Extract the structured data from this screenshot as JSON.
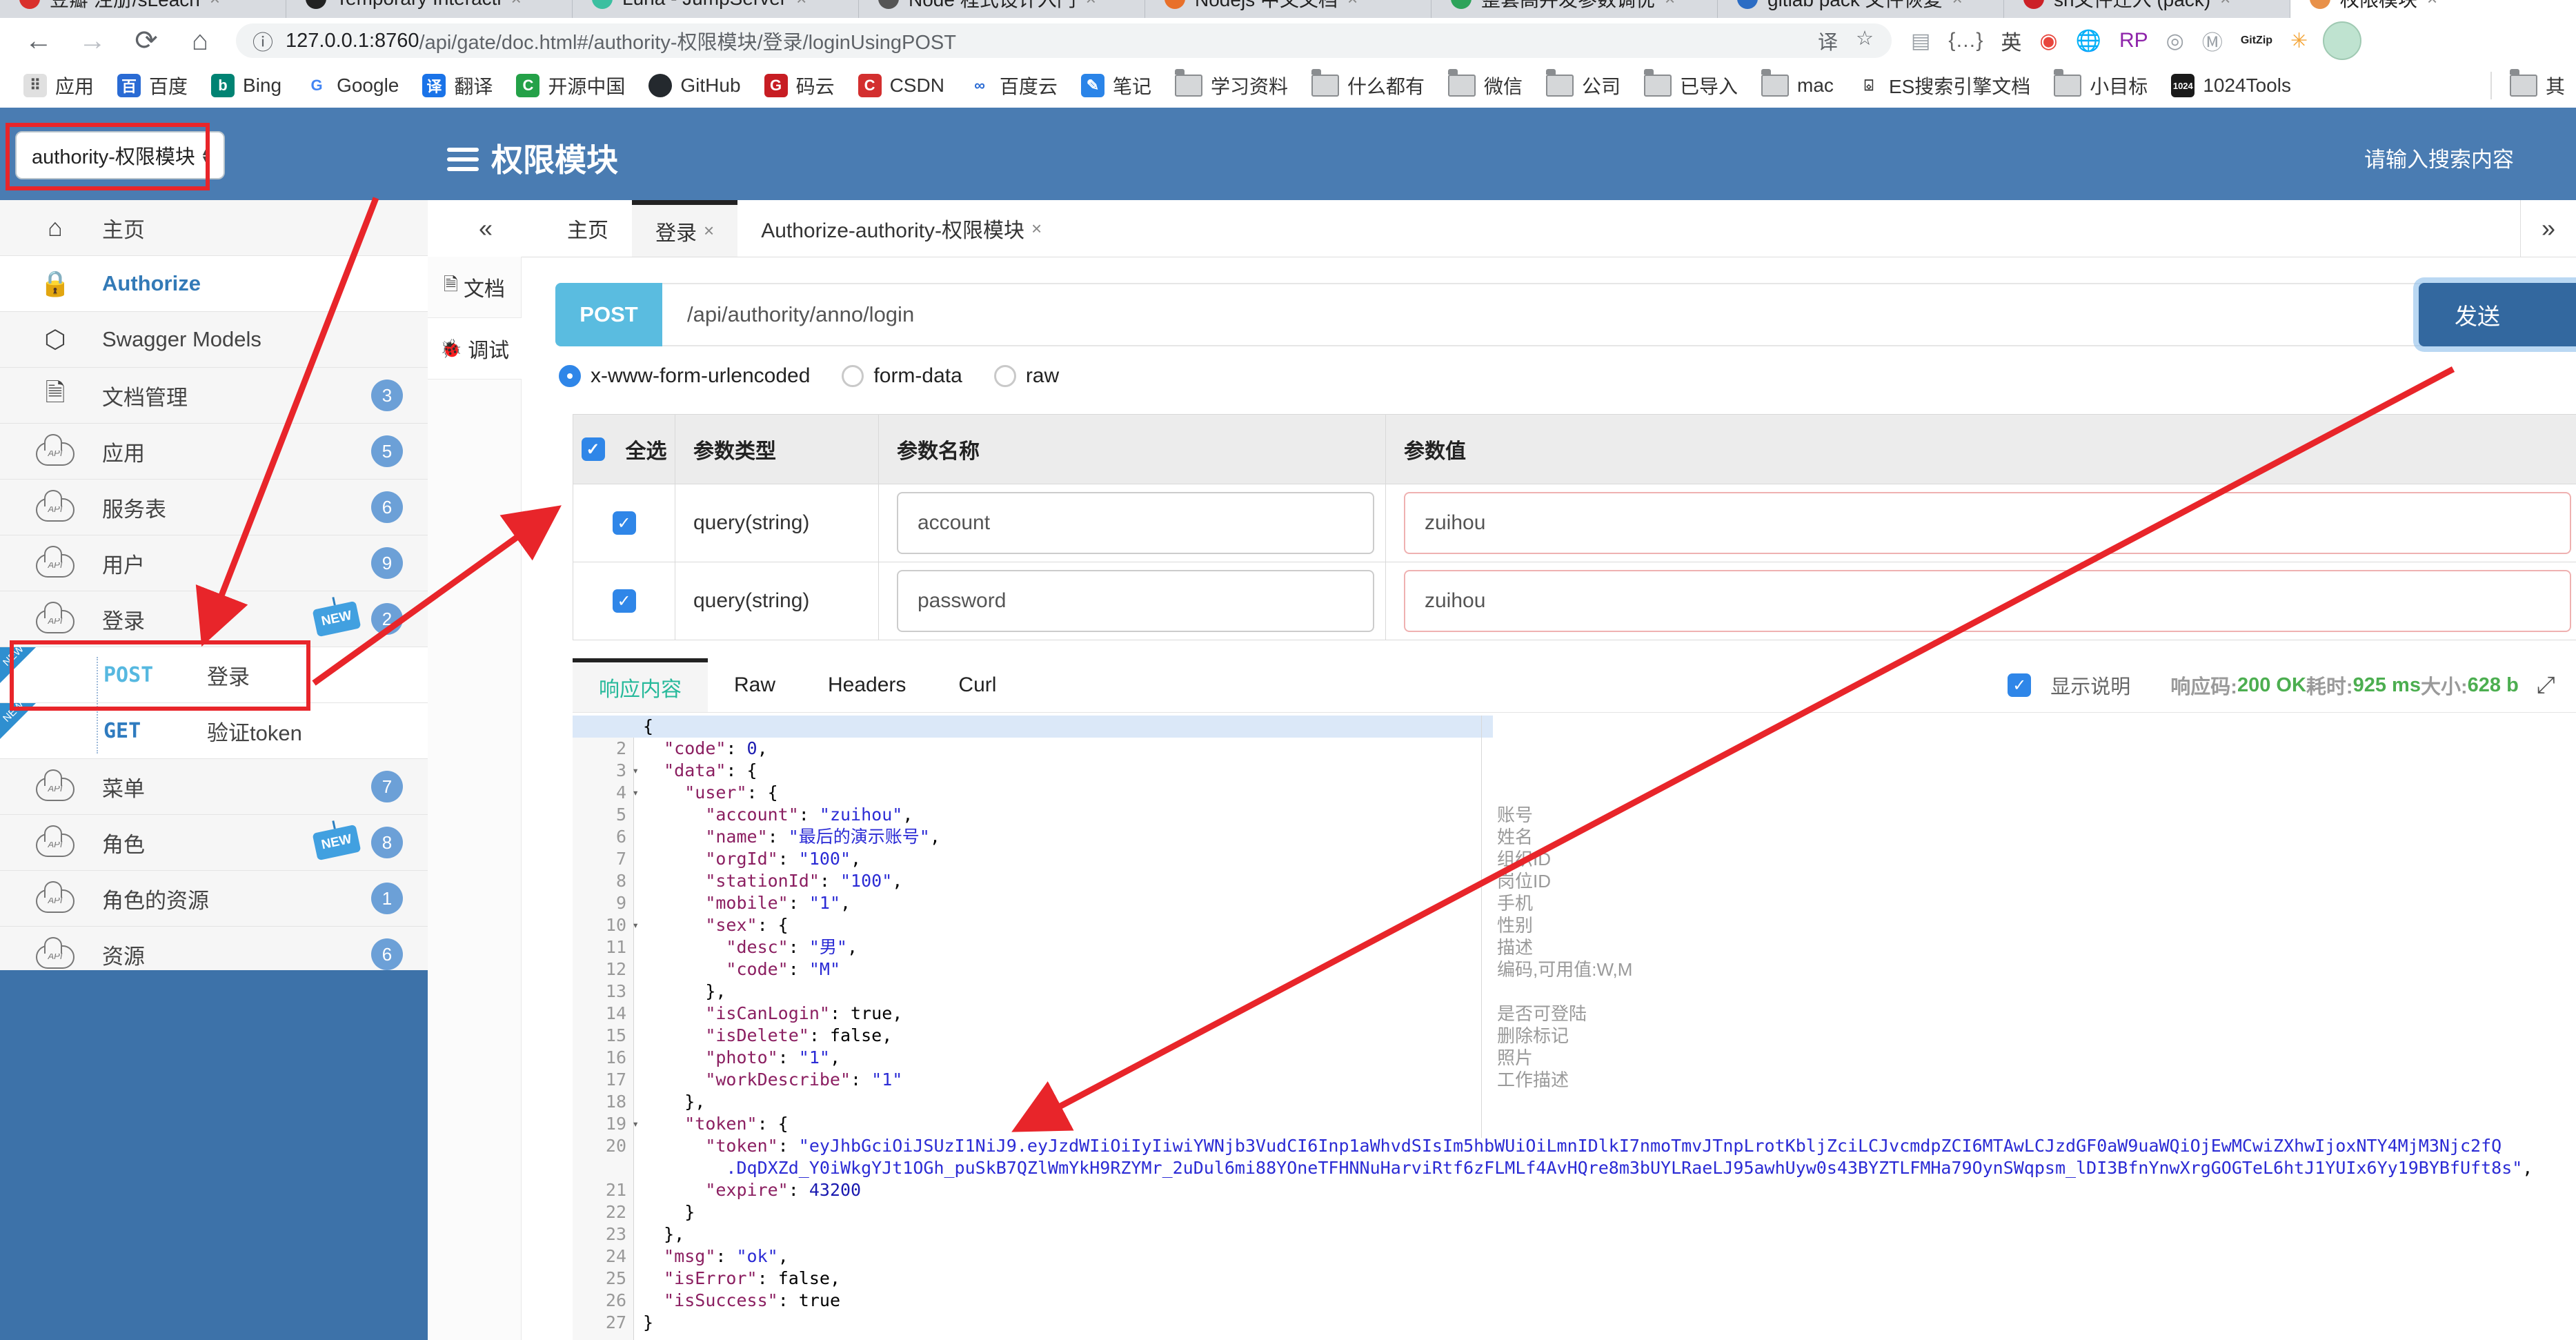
{
  "browser": {
    "tabs": [
      {
        "title": "豆瓣 注册/sLeach",
        "color": "#d9302c",
        "active": false
      },
      {
        "title": "Temporary Interacti",
        "color": "#222222",
        "active": false
      },
      {
        "title": "Luna - JumpServer",
        "color": "#3bbfa0",
        "active": false
      },
      {
        "title": "Node 程式设计入门",
        "color": "#555555",
        "active": false
      },
      {
        "title": "Nodejs 中文文档",
        "color": "#e8702a",
        "active": false
      },
      {
        "title": "整套高并发参数调优",
        "color": "#2da35a",
        "active": false
      },
      {
        "title": "gitlab pack 文件恢复",
        "color": "#2b6cc4",
        "active": false
      },
      {
        "title": "sh文件迁入 (pack)",
        "color": "#cc2127",
        "active": false
      },
      {
        "title": "权限模块",
        "color": "#e8914a",
        "active": true
      }
    ],
    "nav": {
      "back": "←",
      "forward": "→",
      "reload": "⟳",
      "home": "⌂"
    },
    "url": {
      "info_icon": "ⓘ",
      "host": "127.0.0.1:8760",
      "path": "/api/gate/doc.html#/authority-权限模块/登录/loginUsingPOST"
    },
    "pill_icons": {
      "translate": "译",
      "star": "☆"
    },
    "extensions": [
      "reader",
      "json",
      "en-translate",
      "chrome",
      "globe",
      "rp",
      "ring",
      "shield-m",
      "gitzip",
      "asterisk"
    ],
    "bookmarks": [
      {
        "label": "应用",
        "icon": "grid"
      },
      {
        "label": "百度",
        "icon": "blue-paw"
      },
      {
        "label": "Bing",
        "icon": "teal-b"
      },
      {
        "label": "Google",
        "icon": "g"
      },
      {
        "label": "翻译",
        "icon": "blue-trans"
      },
      {
        "label": "开源中国",
        "icon": "green-c"
      },
      {
        "label": "GitHub",
        "icon": "black-cat"
      },
      {
        "label": "码云",
        "icon": "red-g"
      },
      {
        "label": "CSDN",
        "icon": "red-c"
      },
      {
        "label": "百度云",
        "icon": "pan"
      },
      {
        "label": "笔记",
        "icon": "blue-note"
      },
      {
        "label": "学习资料",
        "icon": "folder"
      },
      {
        "label": "什么都有",
        "icon": "folder"
      },
      {
        "label": "微信",
        "icon": "folder"
      },
      {
        "label": "公司",
        "icon": "folder"
      },
      {
        "label": "已导入",
        "icon": "folder"
      },
      {
        "label": "mac",
        "icon": "folder"
      },
      {
        "label": "ES搜索引擎文档",
        "icon": "book"
      },
      {
        "label": "小目标",
        "icon": "folder"
      },
      {
        "label": "1024Tools",
        "icon": "tools1024"
      }
    ],
    "bookmarks_more": "其"
  },
  "header": {
    "module_select": "authority-权限模块",
    "title": "权限模块",
    "search_placeholder": "请输入搜索内容"
  },
  "sidebar": {
    "items": [
      {
        "label": "主页",
        "icon": "home",
        "type": "plain"
      },
      {
        "label": "Authorize",
        "icon": "lock",
        "type": "active"
      },
      {
        "label": "Swagger Models",
        "icon": "hexagon",
        "type": "plain"
      },
      {
        "label": "文档管理",
        "icon": "doc-gear",
        "type": "plain",
        "badge": "3"
      },
      {
        "label": "应用",
        "icon": "cloud-api",
        "type": "plain",
        "badge": "5"
      },
      {
        "label": "服务表",
        "icon": "cloud-api",
        "type": "plain",
        "badge": "6"
      },
      {
        "label": "用户",
        "icon": "cloud-api",
        "type": "plain",
        "badge": "9"
      },
      {
        "label": "登录",
        "icon": "cloud-api",
        "type": "plain",
        "badge": "2",
        "new": true
      },
      {
        "label": "登录",
        "method": "POST",
        "type": "sub",
        "new": true
      },
      {
        "label": "验证token",
        "method": "GET",
        "type": "sub",
        "new": true
      },
      {
        "label": "菜单",
        "icon": "cloud-api",
        "type": "plain",
        "badge": "7"
      },
      {
        "label": "角色",
        "icon": "cloud-api",
        "type": "plain",
        "badge": "8",
        "new": true
      },
      {
        "label": "角色的资源",
        "icon": "cloud-api",
        "type": "plain",
        "badge": "1"
      },
      {
        "label": "资源",
        "icon": "cloud-api",
        "type": "plain",
        "badge": "6"
      }
    ],
    "new_label": "NEW"
  },
  "tabs": {
    "collapse": "«",
    "expand": "»",
    "items": [
      {
        "label": "主页",
        "closable": false,
        "active": false
      },
      {
        "label": "登录",
        "closable": true,
        "active": true
      },
      {
        "label": "Authorize-authority-权限模块",
        "closable": true,
        "active": false
      }
    ],
    "close_glyph": "×"
  },
  "doc_tabs": [
    {
      "label": "文档",
      "icon": "doc",
      "active": false
    },
    {
      "label": "调试",
      "icon": "bug",
      "active": true
    }
  ],
  "request": {
    "method": "POST",
    "url": "/api/authority/anno/login",
    "send_label": "发送",
    "body_types": [
      "x-www-form-urlencoded",
      "form-data",
      "raw"
    ],
    "selected_body": "x-www-form-urlencoded"
  },
  "params": {
    "headers": {
      "select_all": "全选",
      "type": "参数类型",
      "name": "参数名称",
      "value": "参数值"
    },
    "rows": [
      {
        "type": "query(string)",
        "name": "account",
        "value": "zuihou"
      },
      {
        "type": "query(string)",
        "name": "password",
        "value": "zuihou"
      }
    ]
  },
  "response": {
    "tabs": [
      "响应内容",
      "Raw",
      "Headers",
      "Curl"
    ],
    "active_tab": "响应内容",
    "show_desc_label": "显示说明",
    "meta": [
      {
        "label": "响应码:",
        "value": "200 OK"
      },
      {
        "label": "耗时:",
        "value": "925 ms"
      },
      {
        "label": "大小:",
        "value": "628 b"
      }
    ],
    "expand_icon": "⤢"
  },
  "code": {
    "rows": [
      {
        "n": "1",
        "fold": true,
        "indent": 0,
        "seg": [
          [
            "p",
            "{"
          ]
        ],
        "hl": true
      },
      {
        "n": "2",
        "fold": false,
        "indent": 1,
        "seg": [
          [
            "k",
            "\"code\""
          ],
          [
            "p",
            ": "
          ],
          [
            "n",
            "0"
          ],
          [
            "p",
            ","
          ]
        ]
      },
      {
        "n": "3",
        "fold": true,
        "indent": 1,
        "seg": [
          [
            "k",
            "\"data\""
          ],
          [
            "p",
            ": {"
          ]
        ]
      },
      {
        "n": "4",
        "fold": true,
        "indent": 2,
        "seg": [
          [
            "k",
            "\"user\""
          ],
          [
            "p",
            ": {"
          ]
        ]
      },
      {
        "n": "5",
        "fold": false,
        "indent": 3,
        "seg": [
          [
            "k",
            "\"account\""
          ],
          [
            "p",
            ": "
          ],
          [
            "s",
            "\"zuihou\""
          ],
          [
            "p",
            ","
          ]
        ]
      },
      {
        "n": "6",
        "fold": false,
        "indent": 3,
        "seg": [
          [
            "k",
            "\"name\""
          ],
          [
            "p",
            ": "
          ],
          [
            "s",
            "\"最后的演示账号\""
          ],
          [
            "p",
            ","
          ]
        ]
      },
      {
        "n": "7",
        "fold": false,
        "indent": 3,
        "seg": [
          [
            "k",
            "\"orgId\""
          ],
          [
            "p",
            ": "
          ],
          [
            "s",
            "\"100\""
          ],
          [
            "p",
            ","
          ]
        ]
      },
      {
        "n": "8",
        "fold": false,
        "indent": 3,
        "seg": [
          [
            "k",
            "\"stationId\""
          ],
          [
            "p",
            ": "
          ],
          [
            "s",
            "\"100\""
          ],
          [
            "p",
            ","
          ]
        ]
      },
      {
        "n": "9",
        "fold": false,
        "indent": 3,
        "seg": [
          [
            "k",
            "\"mobile\""
          ],
          [
            "p",
            ": "
          ],
          [
            "s",
            "\"1\""
          ],
          [
            "p",
            ","
          ]
        ]
      },
      {
        "n": "10",
        "fold": true,
        "indent": 3,
        "seg": [
          [
            "k",
            "\"sex\""
          ],
          [
            "p",
            ": {"
          ]
        ]
      },
      {
        "n": "11",
        "fold": false,
        "indent": 4,
        "seg": [
          [
            "k",
            "\"desc\""
          ],
          [
            "p",
            ": "
          ],
          [
            "s",
            "\"男\""
          ],
          [
            "p",
            ","
          ]
        ]
      },
      {
        "n": "12",
        "fold": false,
        "indent": 4,
        "seg": [
          [
            "k",
            "\"code\""
          ],
          [
            "p",
            ": "
          ],
          [
            "s",
            "\"M\""
          ]
        ]
      },
      {
        "n": "13",
        "fold": false,
        "indent": 3,
        "seg": [
          [
            "p",
            "},"
          ]
        ]
      },
      {
        "n": "14",
        "fold": false,
        "indent": 3,
        "seg": [
          [
            "k",
            "\"isCanLogin\""
          ],
          [
            "p",
            ": "
          ],
          [
            "b",
            "true"
          ],
          [
            "p",
            ","
          ]
        ]
      },
      {
        "n": "15",
        "fold": false,
        "indent": 3,
        "seg": [
          [
            "k",
            "\"isDelete\""
          ],
          [
            "p",
            ": "
          ],
          [
            "b",
            "false"
          ],
          [
            "p",
            ","
          ]
        ]
      },
      {
        "n": "16",
        "fold": false,
        "indent": 3,
        "seg": [
          [
            "k",
            "\"photo\""
          ],
          [
            "p",
            ": "
          ],
          [
            "s",
            "\"1\""
          ],
          [
            "p",
            ","
          ]
        ]
      },
      {
        "n": "17",
        "fold": false,
        "indent": 3,
        "seg": [
          [
            "k",
            "\"workDescribe\""
          ],
          [
            "p",
            ": "
          ],
          [
            "s",
            "\"1\""
          ]
        ]
      },
      {
        "n": "18",
        "fold": false,
        "indent": 2,
        "seg": [
          [
            "p",
            "},"
          ]
        ]
      },
      {
        "n": "19",
        "fold": true,
        "indent": 2,
        "seg": [
          [
            "k",
            "\"token\""
          ],
          [
            "p",
            ": {"
          ]
        ]
      },
      {
        "n": "20",
        "fold": false,
        "indent": 3,
        "seg": [
          [
            "k",
            "\"token\""
          ],
          [
            "p",
            ": "
          ],
          [
            "s",
            "\"eyJhbGciOiJSUzI1NiJ9.eyJzdWIiOiIyIiwiYWNjb3VudCI6Inp1aWhvdSIsIm5hbWUiOiLmnIDlkI7nmoTmvJTnpLrotKbljZciLCJvcmdpZCI6MTAwLCJzdGF0aW9uaWQiOjEwMCwiZXhwIjoxNTY4MjM3Njc2fQ"
          ]
        ]
      },
      {
        "n": "",
        "fold": false,
        "indent": 4,
        "seg": [
          [
            "s",
            ".DqDXZd_Y0iWkgYJt1OGh_puSkB7QZlWmYkH9RZYMr_2uDul6mi88YOneTFHNNuHarviRtf6zFLMLf4AvHQre8m3bUYLRaeLJ95awhUyw0s43BYZTLFMHa79OynSWqpsm_lDI3BfnYnwXrgGOGTeL6htJ1YUIx6Yy19BYBfUft8s\""
          ],
          [
            "p",
            ","
          ]
        ]
      },
      {
        "n": "21",
        "fold": false,
        "indent": 3,
        "seg": [
          [
            "k",
            "\"expire\""
          ],
          [
            "p",
            ": "
          ],
          [
            "n",
            "43200"
          ]
        ]
      },
      {
        "n": "22",
        "fold": false,
        "indent": 2,
        "seg": [
          [
            "p",
            "}"
          ]
        ]
      },
      {
        "n": "23",
        "fold": false,
        "indent": 1,
        "seg": [
          [
            "p",
            "},"
          ]
        ]
      },
      {
        "n": "24",
        "fold": false,
        "indent": 1,
        "seg": [
          [
            "k",
            "\"msg\""
          ],
          [
            "p",
            ": "
          ],
          [
            "s",
            "\"ok\""
          ],
          [
            "p",
            ","
          ]
        ]
      },
      {
        "n": "25",
        "fold": false,
        "indent": 1,
        "seg": [
          [
            "k",
            "\"isError\""
          ],
          [
            "p",
            ": "
          ],
          [
            "b",
            "false"
          ],
          [
            "p",
            ","
          ]
        ]
      },
      {
        "n": "26",
        "fold": false,
        "indent": 1,
        "seg": [
          [
            "k",
            "\"isSuccess\""
          ],
          [
            "p",
            ": "
          ],
          [
            "b",
            "true"
          ]
        ]
      },
      {
        "n": "27",
        "fold": false,
        "indent": 0,
        "seg": [
          [
            "p",
            "}"
          ]
        ]
      }
    ],
    "annotations": {
      "4": "账号",
      "5": "姓名",
      "6": "组织ID",
      "7": "岗位ID",
      "8": "手机",
      "9": "性别",
      "10": "描述",
      "11": "编码,可用值:W,M",
      "13": "是否可登陆",
      "14": "删除标记",
      "15": "照片",
      "16": "工作描述"
    }
  },
  "colors": {
    "header_blue": "#4a7cb2",
    "sidebar_blue": "#3d72a9",
    "accent_blue": "#337ab7",
    "post_chip": "#5abce0",
    "send_button": "#33689f",
    "success_green": "#4cae50",
    "active_resp_tab": "#26b99a",
    "annotation_red": "#e8252a",
    "badge_blue": "#6ca0d7"
  }
}
